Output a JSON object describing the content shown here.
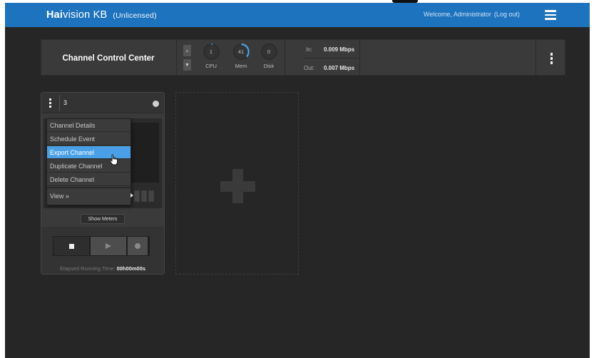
{
  "header": {
    "brand_bold": "Hai",
    "brand_rest": "vision KB",
    "license": "(Unlicensed)",
    "welcome": "Welcome, Administrator",
    "logout": "(Log out)",
    "accent": "#1e73be"
  },
  "control_center": {
    "title": "Channel Control Center",
    "gauges": [
      {
        "value": "1",
        "label": "CPU"
      },
      {
        "value": "41",
        "label": "Mem"
      },
      {
        "value": "0",
        "label": "Disk"
      }
    ],
    "net_in_label": "In:",
    "net_in_value": "0.009 Mbps",
    "net_out_label": "Out:",
    "net_out_value": "0.007 Mbps"
  },
  "channel": {
    "number": "3",
    "show_meters": "Show Meters",
    "elapsed_label": "Elapsed Running Time:",
    "elapsed_value": "00h00m00s"
  },
  "menu": {
    "items": [
      {
        "label": "Channel Details"
      },
      {
        "label": "Schedule Event"
      },
      {
        "label": "Export Channel",
        "active": true
      },
      {
        "label": "Duplicate Channel"
      },
      {
        "label": "Delete Channel"
      },
      {
        "label": "View »"
      }
    ],
    "highlight_color": "#4aa0e6"
  }
}
